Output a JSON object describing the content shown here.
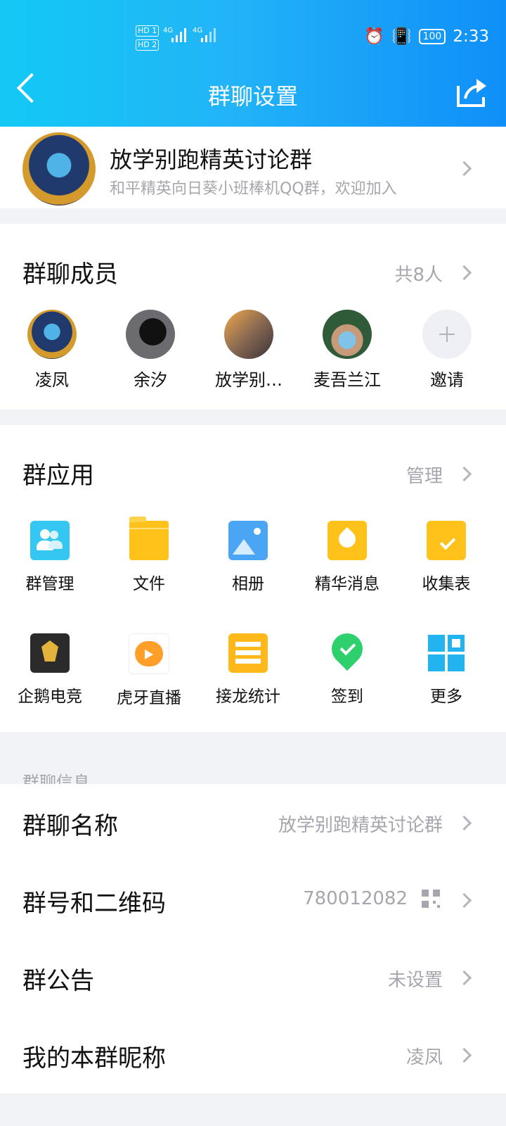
{
  "status": {
    "time": "2:33",
    "battery": "100",
    "hd1": "HD 1",
    "hd2": "HD 2",
    "net1": "4G",
    "net2": "4G"
  },
  "nav": {
    "title": "群聊设置"
  },
  "group": {
    "name": "放学别跑精英讨论群",
    "description": "和平精英向日葵小班棒机QQ群，欢迎加入"
  },
  "members": {
    "title": "群聊成员",
    "count": "共8人",
    "list": [
      {
        "name": "凌凤"
      },
      {
        "name": "余汐"
      },
      {
        "name": "放学别…"
      },
      {
        "name": "麦吾兰江"
      }
    ],
    "invite": "邀请"
  },
  "apps": {
    "title": "群应用",
    "manage": "管理",
    "items": [
      {
        "label": "群管理",
        "icon": "group-manage-icon",
        "color": "#34c7f2"
      },
      {
        "label": "文件",
        "icon": "folder-icon",
        "color": "#ffc21a"
      },
      {
        "label": "相册",
        "icon": "album-icon",
        "color": "#4aa6f5"
      },
      {
        "label": "精华消息",
        "icon": "essence-icon",
        "color": "#ffc21a"
      },
      {
        "label": "收集表",
        "icon": "form-icon",
        "color": "#ffc21a"
      },
      {
        "label": "企鹅电竞",
        "icon": "esports-icon",
        "color": "#2b2b2b"
      },
      {
        "label": "虎牙直播",
        "icon": "huya-icon",
        "color": "#ff9f2a"
      },
      {
        "label": "接龙统计",
        "icon": "solitaire-icon",
        "color": "#ffb81a"
      },
      {
        "label": "签到",
        "icon": "checkin-icon",
        "color": "#2ed06e"
      },
      {
        "label": "更多",
        "icon": "more-grid-icon",
        "color": "#22b4f0"
      }
    ]
  },
  "info": {
    "section_label": "群聊信息",
    "rows": [
      {
        "key": "群聊名称",
        "value": "放学别跑精英讨论群"
      },
      {
        "key": "群号和二维码",
        "value": "780012082"
      },
      {
        "key": "群公告",
        "value": "未设置"
      },
      {
        "key": "我的本群昵称",
        "value": "凌凤"
      }
    ]
  }
}
